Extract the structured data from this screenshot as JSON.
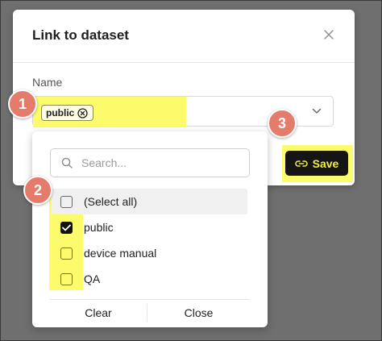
{
  "modal": {
    "title": "Link to dataset",
    "field_label": "Name",
    "selected_chip": "public",
    "save_label": "Save"
  },
  "dropdown": {
    "search_placeholder": "Search...",
    "options": [
      {
        "label": "(Select all)",
        "checked": false
      },
      {
        "label": "public",
        "checked": true
      },
      {
        "label": "device manual",
        "checked": false
      },
      {
        "label": "QA",
        "checked": false
      }
    ],
    "clear_label": "Clear",
    "close_label": "Close"
  },
  "annotations": {
    "steps": [
      "1",
      "2",
      "3"
    ],
    "badge_color": "#e57b6b",
    "highlight_color": "#fbfb6c"
  },
  "icons": {
    "close": "close-icon",
    "chip_remove": "circle-x-icon",
    "chevron": "chevron-down-icon",
    "link": "link-icon",
    "search": "search-icon",
    "check": "check-icon"
  },
  "colors": {
    "save_button_bg": "#151515",
    "save_button_text": "#f6f03a",
    "backdrop": "#6f6f6f"
  }
}
